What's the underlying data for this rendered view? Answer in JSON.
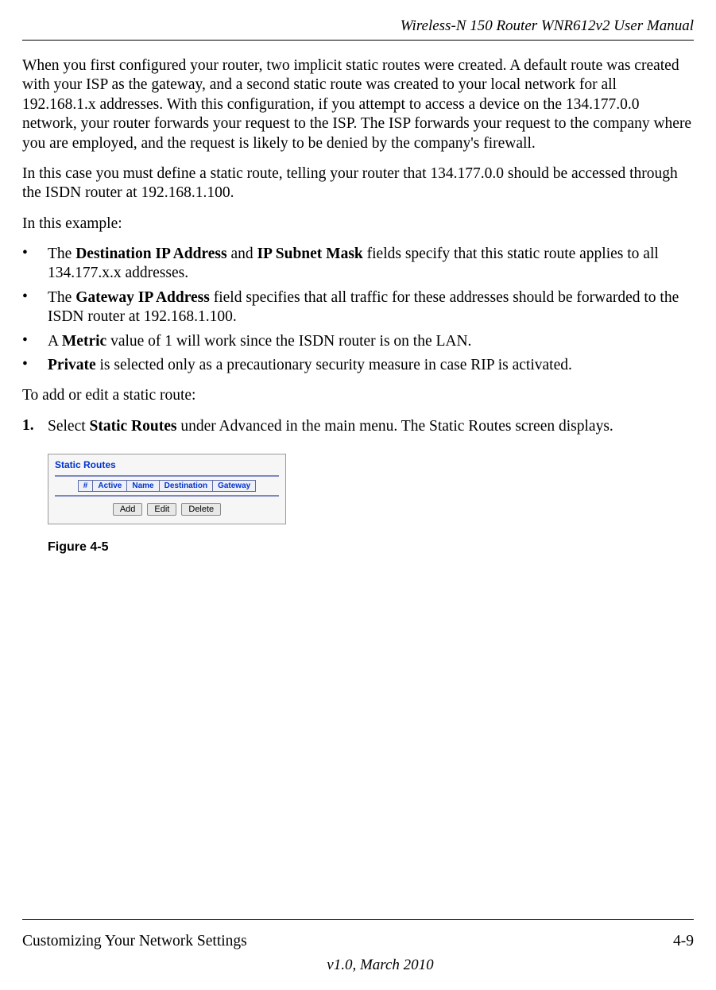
{
  "header": {
    "title": "Wireless-N 150 Router WNR612v2 User Manual"
  },
  "body": {
    "para1": "When you first configured your router, two implicit static routes were created. A default route was created with your ISP as the gateway, and a second static route was created to your local network for all 192.168.1.x addresses. With this configuration, if you attempt to access a device on the 134.177.0.0 network, your router forwards your request to the ISP. The ISP forwards your request to the company where you are employed, and the request is likely to be denied by the company's firewall.",
    "para2": "In this case you must define a static route, telling your router that 134.177.0.0 should be accessed through the ISDN router at 192.168.1.100.",
    "para3": "In this example:",
    "bullets": [
      {
        "pre": "The ",
        "bold1": "Destination IP Address",
        "mid": " and ",
        "bold2": "IP Subnet Mask",
        "post": " fields specify that this static route applies to all 134.177.x.x addresses."
      },
      {
        "pre": "The ",
        "bold1": "Gateway IP Address",
        "post": " field specifies that all traffic for these addresses should be forwarded to the ISDN router at 192.168.1.100."
      },
      {
        "pre": "A ",
        "bold1": "Metric",
        "post": " value of 1 will work since the ISDN router is on the LAN."
      },
      {
        "bold1": "Private",
        "post": " is selected only as a precautionary security measure in case RIP is activated."
      }
    ],
    "postlist": "To add or edit a static route:",
    "step1": {
      "num": "1.",
      "pre": "Select ",
      "bold": "Static Routes",
      "post": " under Advanced in the main menu. The Static Routes screen displays."
    }
  },
  "figure": {
    "title": "Static Routes",
    "headers": [
      "#",
      "Active",
      "Name",
      "Destination",
      "Gateway"
    ],
    "buttons": {
      "add": "Add",
      "edit": "Edit",
      "delete": "Delete"
    },
    "caption": "Figure 4-5"
  },
  "footer": {
    "section": "Customizing Your Network Settings",
    "pageNum": "4-9",
    "version": "v1.0, March 2010"
  }
}
